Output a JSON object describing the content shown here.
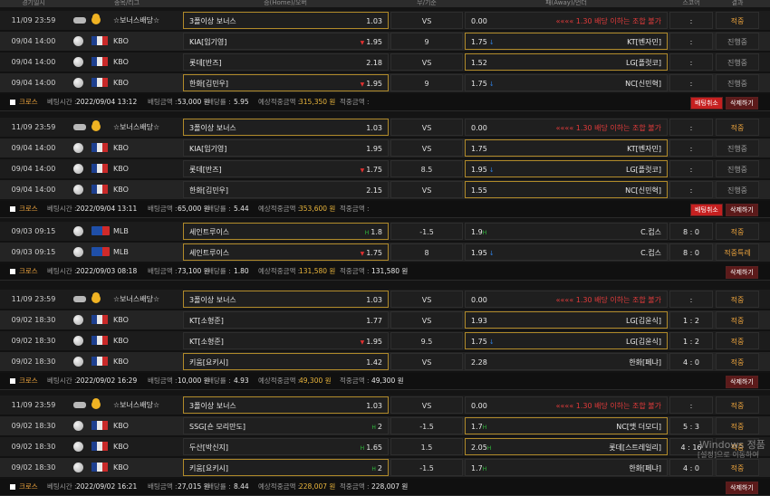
{
  "header": [
    "경기일시",
    "종목/리그",
    "승(Home)/오버",
    "무/기준",
    "패(Away)/언더",
    "스코어",
    "결과"
  ],
  "groups": [
    {
      "rows": [
        {
          "date": "11/09 23:59",
          "sport": "bonus",
          "league": "☆보너스배당☆",
          "home": "3폴이상 보너스",
          "home_odd": "1.03",
          "home_bonus": true,
          "home_sel": true,
          "mid": "VS",
          "away_odd": "0.00",
          "away": "«««« 1.30 배당 이하는 조합 불가",
          "away_bonus": true,
          "score": ":",
          "result": "적중",
          "res": "ok"
        },
        {
          "date": "09/04 14:00",
          "sport": "baseball",
          "league": "KBO",
          "home": "KIA[임기영]",
          "home_odd": "1.95",
          "home_arrow": "down",
          "mid": "9",
          "away_odd": "1.75",
          "away_arrow": "down",
          "away": "KT[벤자민]",
          "away_sel": true,
          "score": ":",
          "result": "진행중",
          "res": "ing"
        },
        {
          "date": "09/04 14:00",
          "sport": "baseball",
          "league": "KBO",
          "home": "롯데[반즈]",
          "home_odd": "2.18",
          "mid": "VS",
          "away_odd": "1.52",
          "away": "LG[플럿코]",
          "away_sel": true,
          "score": ":",
          "result": "진행중",
          "res": "ing"
        },
        {
          "date": "09/04 14:00",
          "sport": "baseball",
          "league": "KBO",
          "home": "한화[김민우]",
          "home_odd": "1.95",
          "home_arrow": "down",
          "home_sel": true,
          "mid": "9",
          "away_odd": "1.75",
          "away_arrow": "down",
          "away": "NC[신민혁]",
          "score": ":",
          "result": "진행중",
          "res": "ing"
        }
      ],
      "summary": {
        "cross": "크로스",
        "time_label": "베팅시간 :",
        "time": "2022/09/04 13:12",
        "amount_label": "배팅금액 :",
        "amount": "53,000 원",
        "odds_label": "배당률 :",
        "odds": "5.95",
        "expected_label": "예상적중금액 :",
        "expected": "315,350 원",
        "hit_label": "적중금액 :",
        "hit": "",
        "cancel": "배팅취소",
        "del": "삭제하기"
      }
    },
    {
      "rows": [
        {
          "date": "11/09 23:59",
          "sport": "bonus",
          "league": "☆보너스배당☆",
          "home": "3폴이상 보너스",
          "home_odd": "1.03",
          "home_bonus": true,
          "home_sel": true,
          "mid": "VS",
          "away_odd": "0.00",
          "away": "«««« 1.30 배당 이하는 조합 불가",
          "away_bonus": true,
          "score": ":",
          "result": "적중",
          "res": "ok"
        },
        {
          "date": "09/04 14:00",
          "sport": "baseball",
          "league": "KBO",
          "home": "KIA[임기영]",
          "home_odd": "1.95",
          "mid": "VS",
          "away_odd": "1.75",
          "away": "KT[벤자민]",
          "away_sel": true,
          "score": ":",
          "result": "진행중",
          "res": "ing"
        },
        {
          "date": "09/04 14:00",
          "sport": "baseball",
          "league": "KBO",
          "home": "롯데[반즈]",
          "home_odd": "1.75",
          "home_arrow": "down",
          "mid": "8.5",
          "away_odd": "1.95",
          "away_arrow": "down",
          "away": "LG[플럿코]",
          "away_sel": true,
          "score": ":",
          "result": "진행중",
          "res": "ing"
        },
        {
          "date": "09/04 14:00",
          "sport": "baseball",
          "league": "KBO",
          "home": "한화[김민우]",
          "home_odd": "2.15",
          "mid": "VS",
          "away_odd": "1.55",
          "away": "NC[신민혁]",
          "away_sel": true,
          "score": ":",
          "result": "진행중",
          "res": "ing"
        }
      ],
      "summary": {
        "cross": "크로스",
        "time_label": "베팅시간 :",
        "time": "2022/09/04 13:11",
        "amount_label": "배팅금액 :",
        "amount": "65,000 원",
        "odds_label": "배당률 :",
        "odds": "5.44",
        "expected_label": "예상적중금액 :",
        "expected": "353,600 원",
        "hit_label": "적중금액 :",
        "hit": "",
        "cancel": "배팅취소",
        "del": "삭제하기"
      }
    },
    {
      "rows": [
        {
          "date": "09/03 09:15",
          "sport": "baseball",
          "league": "MLB",
          "home": "세인트루이스",
          "home_odd": "1.8",
          "home_arrow": "up",
          "home_sel": true,
          "mid": "-1.5",
          "away_odd": "1.9",
          "away_arrow": "up",
          "away": "C.컵스",
          "score": "8 : 0",
          "result": "적중",
          "res": "ok"
        },
        {
          "date": "09/03 09:15",
          "sport": "baseball",
          "league": "MLB",
          "home": "세인트루이스",
          "home_odd": "1.75",
          "home_arrow": "down",
          "home_sel": true,
          "mid": "8",
          "away_odd": "1.95",
          "away_arrow": "down",
          "away": "C.컵스",
          "score": "8 : 0",
          "result": "적중특례",
          "res": "ok"
        }
      ],
      "summary": {
        "cross": "크로스",
        "time_label": "베팅시간 :",
        "time": "2022/09/03 08:18",
        "amount_label": "배팅금액 :",
        "amount": "73,100 원",
        "odds_label": "배당률 :",
        "odds": "1.80",
        "expected_label": "예상적중금액 :",
        "expected": "131,580 원",
        "hit_label": "적중금액 :",
        "hit": "131,580 원",
        "cancel": "",
        "del": "삭제하기"
      }
    },
    {
      "rows": [
        {
          "date": "11/09 23:59",
          "sport": "bonus",
          "league": "☆보너스배당☆",
          "home": "3폴이상 보너스",
          "home_odd": "1.03",
          "home_bonus": true,
          "home_sel": true,
          "mid": "VS",
          "away_odd": "0.00",
          "away": "«««« 1.30 배당 이하는 조합 불가",
          "away_bonus": true,
          "score": ":",
          "result": "적중",
          "res": "ok"
        },
        {
          "date": "09/02 18:30",
          "sport": "baseball",
          "league": "KBO",
          "home": "KT[소형준]",
          "home_odd": "1.77",
          "mid": "VS",
          "away_odd": "1.93",
          "away": "LG[김윤식]",
          "away_sel": true,
          "score": "1 : 2",
          "result": "적중",
          "res": "ok"
        },
        {
          "date": "09/02 18:30",
          "sport": "baseball",
          "league": "KBO",
          "home": "KT[소형준]",
          "home_odd": "1.95",
          "home_arrow": "down",
          "mid": "9.5",
          "away_odd": "1.75",
          "away_arrow": "down",
          "away": "LG[김윤식]",
          "away_sel": true,
          "score": "1 : 2",
          "result": "적중",
          "res": "ok"
        },
        {
          "date": "09/02 18:30",
          "sport": "baseball",
          "league": "KBO",
          "home": "키움[요키시]",
          "home_odd": "1.42",
          "home_sel": true,
          "mid": "VS",
          "away_odd": "2.28",
          "away": "한화[페냐]",
          "score": "4 : 0",
          "result": "적중",
          "res": "ok"
        }
      ],
      "summary": {
        "cross": "크로스",
        "time_label": "베팅시간 :",
        "time": "2022/09/02 16:29",
        "amount_label": "배팅금액 :",
        "amount": "10,000 원",
        "odds_label": "배당률 :",
        "odds": "4.93",
        "expected_label": "예상적중금액 :",
        "expected": "49,300 원",
        "hit_label": "적중금액 :",
        "hit": "49,300 원",
        "cancel": "",
        "del": "삭제하기"
      }
    },
    {
      "rows": [
        {
          "date": "11/09 23:59",
          "sport": "bonus",
          "league": "☆보너스배당☆",
          "home": "3폴이상 보너스",
          "home_odd": "1.03",
          "home_bonus": true,
          "home_sel": true,
          "mid": "VS",
          "away_odd": "0.00",
          "away": "«««« 1.30 배당 이하는 조합 불가",
          "away_bonus": true,
          "score": ":",
          "result": "적중",
          "res": "ok"
        },
        {
          "date": "09/02 18:30",
          "sport": "baseball",
          "league": "KBO",
          "home": "SSG[숀 모리만도]",
          "home_odd": "2",
          "home_arrow": "up",
          "mid": "-1.5",
          "away_odd": "1.7",
          "away_arrow": "up",
          "away": "NC[맷 더모디]",
          "away_sel": true,
          "score": "5 : 3",
          "result": "적중",
          "res": "ok"
        },
        {
          "date": "09/02 18:30",
          "sport": "baseball",
          "league": "KBO",
          "home": "두산[박신지]",
          "home_odd": "1.65",
          "home_arrow": "up",
          "mid": "1.5",
          "away_odd": "2.05",
          "away_arrow": "up",
          "away": "롯데[스트레일리]",
          "away_sel": true,
          "score": "4 : 16",
          "result": "적중",
          "res": "ok"
        },
        {
          "date": "09/02 18:30",
          "sport": "baseball",
          "league": "KBO",
          "home": "키움[요키시]",
          "home_odd": "2",
          "home_arrow": "up",
          "home_sel": true,
          "mid": "-1.5",
          "away_odd": "1.7",
          "away_arrow": "up",
          "away": "한화[페냐]",
          "score": "4 : 0",
          "result": "적중",
          "res": "ok"
        }
      ],
      "summary": {
        "cross": "크로스",
        "time_label": "베팅시간 :",
        "time": "2022/09/02 16:21",
        "amount_label": "배팅금액 :",
        "amount": "27,015 원",
        "odds_label": "배당률 :",
        "odds": "8.44",
        "expected_label": "예상적중금액 :",
        "expected": "228,007 원",
        "hit_label": "적중금액 :",
        "hit": "228,007 원",
        "cancel": "",
        "del": "삭제하기"
      }
    }
  ],
  "watermark": {
    "line1": "Windows 정품",
    "line2": "[설정]으로 이동하여"
  }
}
